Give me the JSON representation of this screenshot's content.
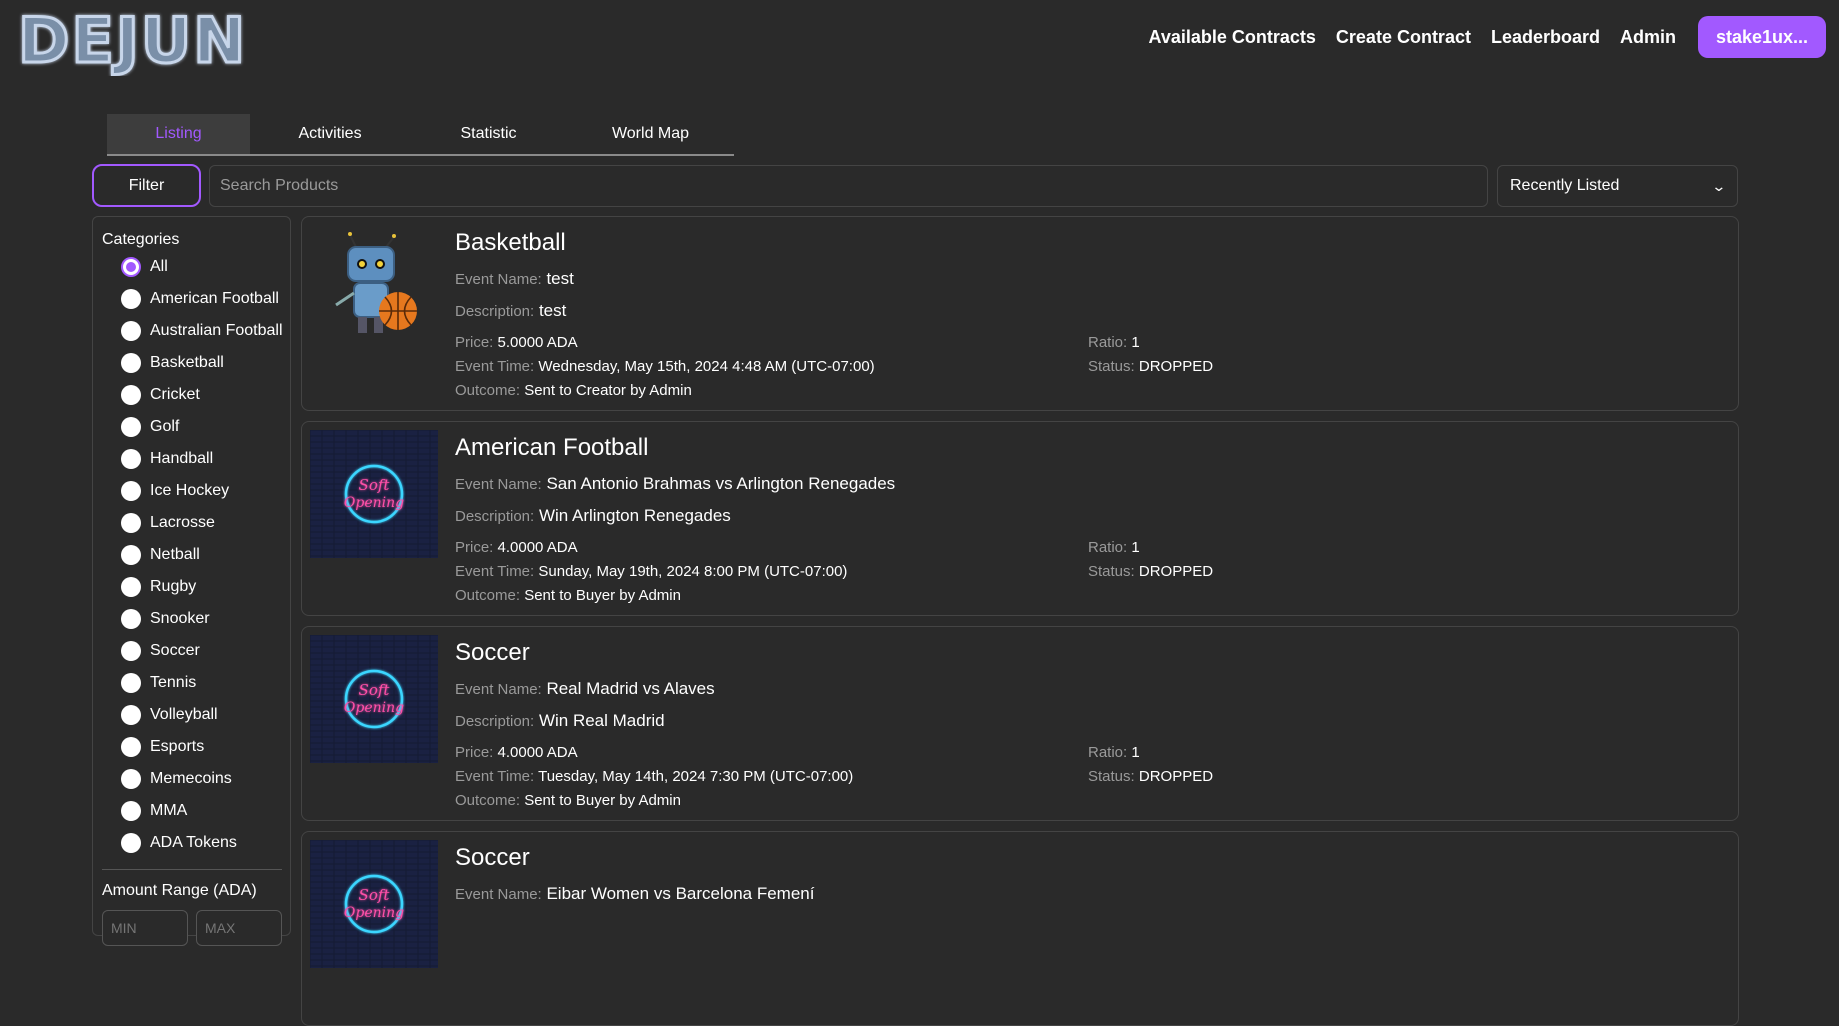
{
  "header": {
    "logo_text": "DEJUN",
    "nav": [
      "Available Contracts",
      "Create Contract",
      "Leaderboard",
      "Admin"
    ],
    "wallet_label": "stake1ux..."
  },
  "tabs": [
    "Listing",
    "Activities",
    "Statistic",
    "World Map"
  ],
  "active_tab": "Listing",
  "filter_label": "Filter",
  "search": {
    "placeholder": "Search Products",
    "value": ""
  },
  "sort": {
    "selected": "Recently Listed"
  },
  "sidebar": {
    "categories_title": "Categories",
    "categories": [
      "All",
      "American Football",
      "Australian Football",
      "Basketball",
      "Cricket",
      "Golf",
      "Handball",
      "Ice Hockey",
      "Lacrosse",
      "Netball",
      "Rugby",
      "Snooker",
      "Soccer",
      "Tennis",
      "Volleyball",
      "Esports",
      "Memecoins",
      "MMA",
      "ADA Tokens"
    ],
    "selected_category": "All",
    "amount_title": "Amount Range (ADA)",
    "min_placeholder": "MIN",
    "max_placeholder": "MAX"
  },
  "labels": {
    "event_name": "Event Name:",
    "description": "Description:",
    "price": "Price:",
    "event_time": "Event Time:",
    "outcome": "Outcome:",
    "ratio": "Ratio:",
    "status": "Status:"
  },
  "products": [
    {
      "title": "Basketball",
      "event_name": "test",
      "description": "test",
      "price": "5.0000 ADA",
      "event_time": "Wednesday, May 15th, 2024 4:48 AM (UTC-07:00)",
      "outcome": "Sent to Creator by Admin",
      "ratio": "1",
      "status": "DROPPED",
      "image": "robot-basketball"
    },
    {
      "title": "American Football",
      "event_name": "San Antonio Brahmas vs Arlington Renegades",
      "description": "Win Arlington Renegades",
      "price": "4.0000 ADA",
      "event_time": "Sunday, May 19th, 2024 8:00 PM (UTC-07:00)",
      "outcome": "Sent to Buyer by Admin",
      "ratio": "1",
      "status": "DROPPED",
      "image": "soft-opening-neon",
      "image_text": [
        "Soft",
        "Opening"
      ]
    },
    {
      "title": "Soccer",
      "event_name": "Real Madrid vs Alaves",
      "description": "Win Real Madrid",
      "price": "4.0000 ADA",
      "event_time": "Tuesday, May 14th, 2024 7:30 PM (UTC-07:00)",
      "outcome": "Sent to Buyer by Admin",
      "ratio": "1",
      "status": "DROPPED",
      "image": "soft-opening-neon",
      "image_text": [
        "Soft",
        "Opening"
      ]
    },
    {
      "title": "Soccer",
      "event_name": "Eibar Women vs Barcelona Femení",
      "description": "",
      "price": "",
      "event_time": "",
      "outcome": "",
      "ratio": "",
      "status": "",
      "image": "soft-opening-neon",
      "image_text": [
        "Soft",
        "Opening"
      ]
    }
  ],
  "colors": {
    "background": "#2a2a2a",
    "accent": "#a259ff",
    "muted_text": "#9a9a9a",
    "border": "#444444"
  }
}
